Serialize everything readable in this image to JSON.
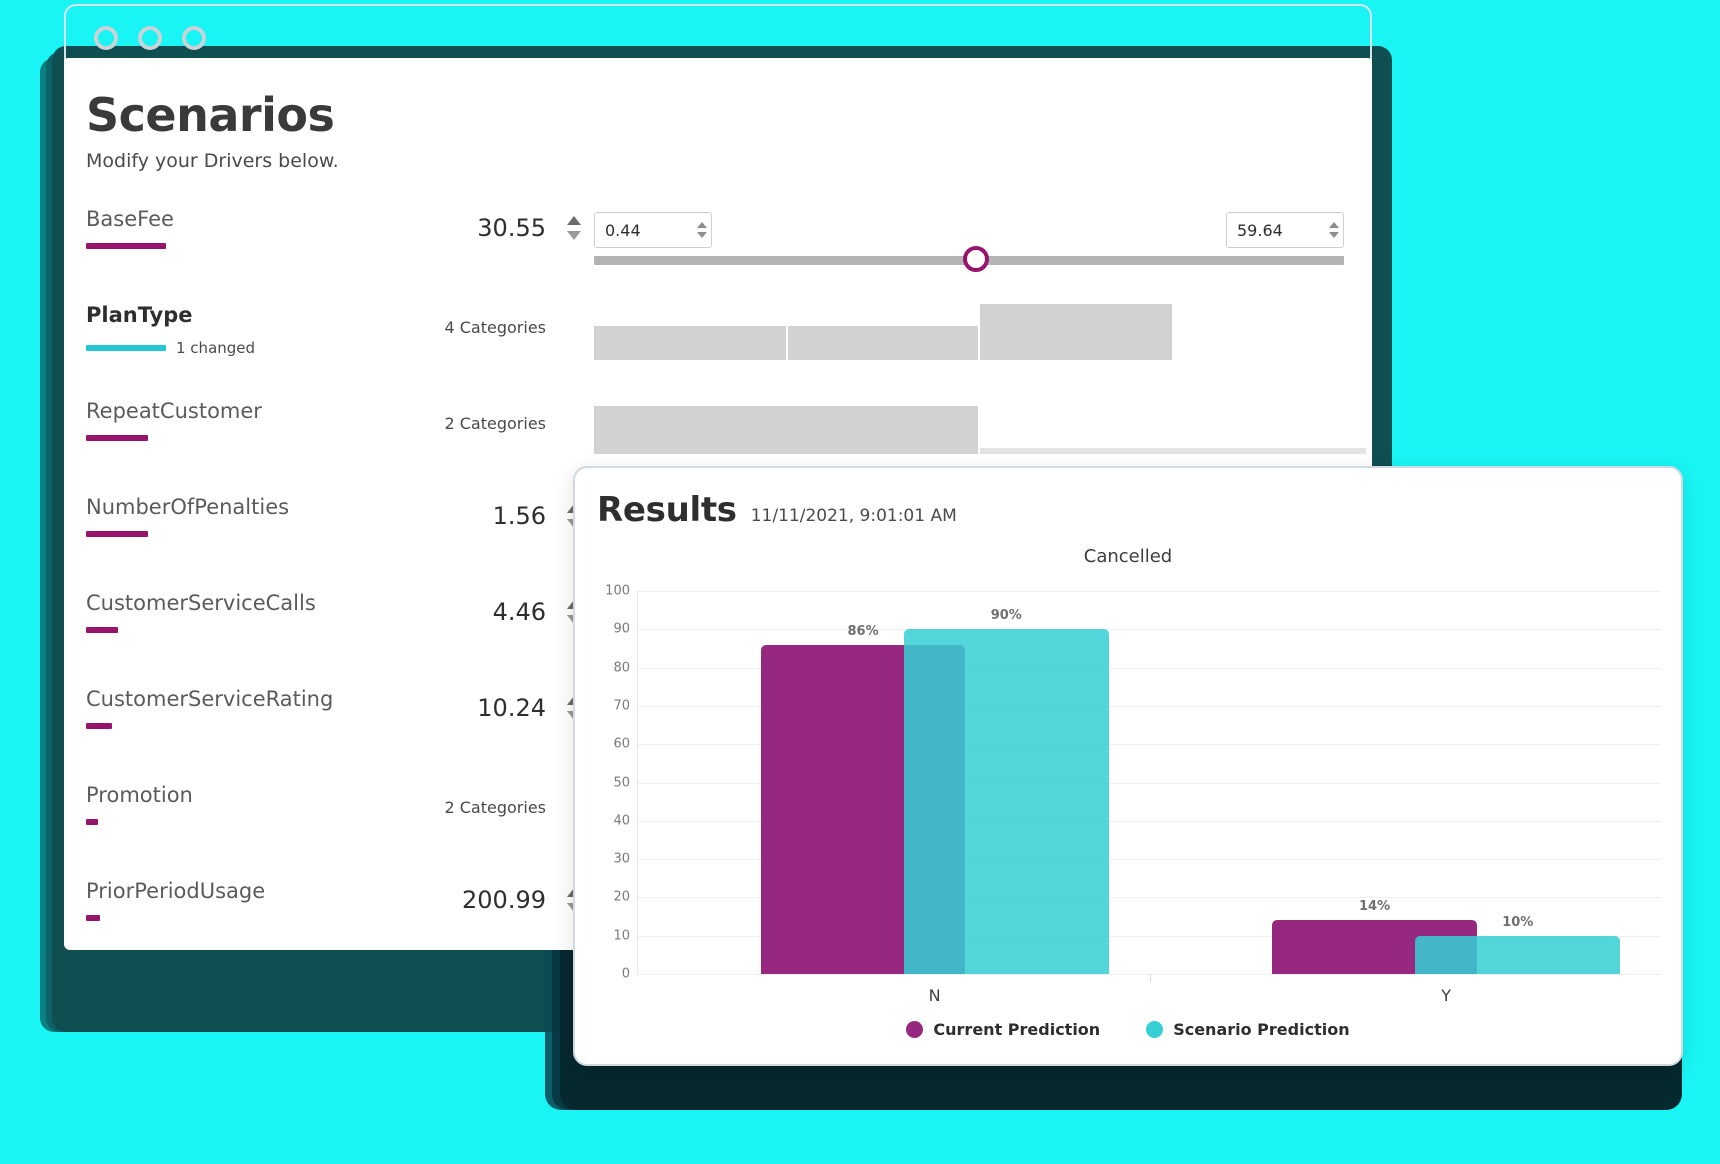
{
  "window_controls": [
    "circle-1",
    "circle-2",
    "circle-3"
  ],
  "scenarios": {
    "title": "Scenarios",
    "subtitle": "Modify your Drivers below.",
    "drivers": [
      {
        "name": "BaseFee",
        "value": "30.55",
        "type": "slider",
        "min_value": "0.44",
        "max_value": "59.64",
        "importance": 80,
        "bold": false
      },
      {
        "name": "PlanType",
        "categories_label": "4 Categories",
        "type": "categories",
        "importance": 80,
        "bold": true,
        "changed_label": "1 changed",
        "accent": "cyan"
      },
      {
        "name": "RepeatCustomer",
        "categories_label": "2 Categories",
        "type": "categories",
        "importance": 62,
        "bold": false
      },
      {
        "name": "NumberOfPenalties",
        "value": "1.56",
        "type": "numeric",
        "min_value": "0",
        "importance": 62,
        "bold": false
      },
      {
        "name": "CustomerServiceCalls",
        "value": "4.46",
        "type": "numeric",
        "min_value": "0",
        "importance": 32,
        "bold": false
      },
      {
        "name": "CustomerServiceRating",
        "value": "10.24",
        "type": "numeric",
        "min_value": "0",
        "importance": 26,
        "bold": false
      },
      {
        "name": "Promotion",
        "categories_label": "2 Categories",
        "type": "categories",
        "importance": 12,
        "bold": false
      },
      {
        "name": "PriorPeriodUsage",
        "value": "200.99",
        "type": "numeric",
        "min_value": "0",
        "importance": 14,
        "bold": false
      }
    ]
  },
  "results": {
    "title": "Results",
    "timestamp": "11/11/2021, 9:01:01 AM"
  },
  "chart_data": {
    "type": "bar",
    "title": "Cancelled",
    "categories": [
      "N",
      "Y"
    ],
    "series": [
      {
        "name": "Current Prediction",
        "values": [
          86,
          14
        ],
        "labels": [
          "86%",
          "14%"
        ],
        "color": "#96297f"
      },
      {
        "name": "Scenario Prediction",
        "values": [
          90,
          10
        ],
        "labels": [
          "90%",
          "10%"
        ],
        "color": "#35cfd4"
      }
    ],
    "ylim": [
      0,
      100
    ],
    "yticks": [
      0,
      10,
      20,
      30,
      40,
      50,
      60,
      70,
      80,
      90,
      100
    ],
    "ytick_labels": [
      "0",
      "10",
      "20",
      "30",
      "40",
      "50",
      "60",
      "70",
      "80",
      "90",
      "100"
    ],
    "xlabel": "",
    "ylabel": "",
    "grid": true,
    "legend_position": "bottom"
  },
  "colors": {
    "page_background": "#19F5F5",
    "accent_magenta": "#96146e",
    "accent_cyan": "#25c7d3",
    "current_prediction": "#96297f",
    "scenario_prediction": "#35cfd4"
  }
}
